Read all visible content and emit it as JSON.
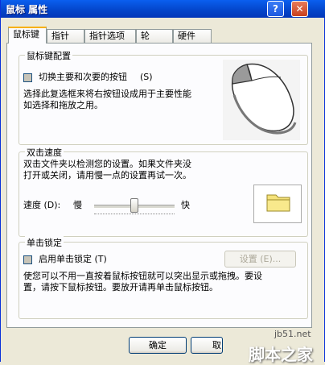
{
  "window": {
    "title": "鼠标 属性",
    "help_glyph": "?",
    "close_glyph": "✕"
  },
  "tabs": [
    {
      "label": "鼠标键",
      "active": true
    },
    {
      "label": "指针",
      "active": false
    },
    {
      "label": "指针选项",
      "active": false
    },
    {
      "label": "轮",
      "active": false
    },
    {
      "label": "硬件",
      "active": false
    }
  ],
  "buttons_config": {
    "title": "鼠标键配置",
    "switch_label": "切换主要和次要的按钮",
    "switch_shortcut": "(S)",
    "switch_checked": false,
    "description": [
      "选择此复选框来将右按钮设成用于主要性能",
      "如选择和拖放之用。"
    ]
  },
  "double_click": {
    "title": "双击速度",
    "description": [
      "双击文件夹以检测您的设置。如果文件夹没",
      "打开或关闭，请用慢一点的设置再试一次。"
    ],
    "speed_label": "速度 (D):",
    "slow_label": "慢",
    "fast_label": "快",
    "speed_value_fraction": 0.5
  },
  "click_lock": {
    "title": "单击锁定",
    "enable_label": "启用单击锁定 (T)",
    "enable_checked": false,
    "settings_button": "设置 (E)...",
    "description": [
      "使您可以不用一直按着鼠标按钮就可以突出显示或拖拽。要设",
      "置，请按下鼠标按钮。要放开请再单击鼠标按钮。"
    ]
  },
  "footer": {
    "ok_label": "确定",
    "cancel_label": "取"
  },
  "watermark": {
    "site": "jb51.net",
    "brand": "脚本之家"
  },
  "icons": {
    "mouse": "mouse-illustration",
    "folder": "folder-icon"
  }
}
